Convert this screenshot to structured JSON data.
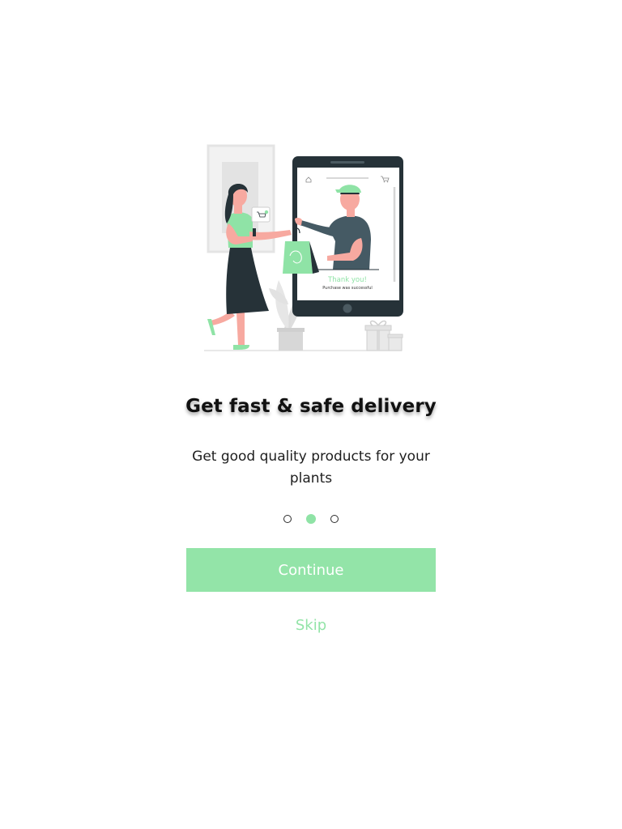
{
  "onboarding": {
    "title": "Get fast & safe delivery",
    "subtitle": "Get good quality products for your plants",
    "continue_label": "Continue",
    "skip_label": "Skip",
    "page_dots": {
      "count": 3,
      "active_index": 1
    }
  },
  "illustration": {
    "thank_you_text": "Thank you!",
    "purchase_text": "Purchase was successful"
  },
  "colors": {
    "accent": "#93e4a8",
    "dark": "#263238",
    "background": "#ffffff",
    "skin": "#f7a9a0"
  },
  "icons": [
    "home-icon",
    "cart-icon"
  ]
}
